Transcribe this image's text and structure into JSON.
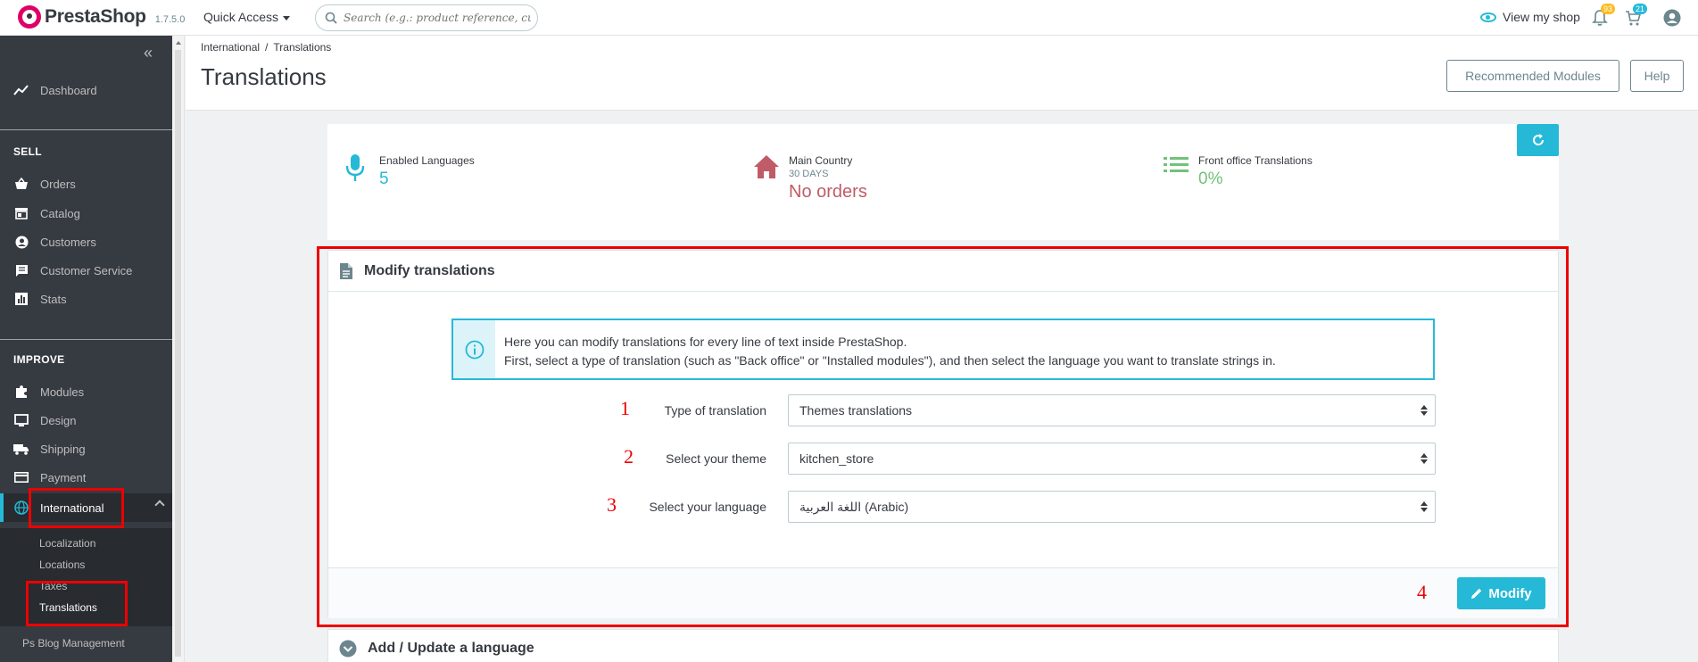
{
  "app": {
    "logo_text": "PrestaShop",
    "version": "1.7.5.0",
    "quick_access": "Quick Access",
    "search_placeholder": "Search (e.g.: product reference, customer name...)",
    "view_shop": "View my shop",
    "notifications_badge": "93",
    "orders_badge": "21",
    "accent_color": "#25b9d7"
  },
  "sidebar": {
    "dashboard": "Dashboard",
    "sell_title": "SELL",
    "sell_items": [
      "Orders",
      "Catalog",
      "Customers",
      "Customer Service",
      "Stats"
    ],
    "improve_title": "IMPROVE",
    "improve_items": [
      "Modules",
      "Design",
      "Shipping",
      "Payment"
    ],
    "active_item": "International",
    "submenu": [
      "Localization",
      "Locations",
      "Taxes",
      "Translations"
    ],
    "blog_item": "Ps Blog Management"
  },
  "header": {
    "breadcrumb": [
      "International",
      "Translations"
    ],
    "title": "Translations",
    "recommended_btn": "Recommended Modules",
    "help_btn": "Help"
  },
  "kpis": {
    "enabled_languages_label": "Enabled Languages",
    "enabled_languages_value": "5",
    "main_country_label": "Main Country",
    "main_country_sub": "30 DAYS",
    "main_country_value": "No orders",
    "front_office_label": "Front office Translations",
    "front_office_value": "0%"
  },
  "modify_panel": {
    "title": "Modify translations",
    "info_line1": "Here you can modify translations for every line of text inside PrestaShop.",
    "info_line2": "First, select a type of translation (such as \"Back office\" or \"Installed modules\"), and then select the language you want to translate strings in.",
    "rows": [
      {
        "step": "1",
        "label": "Type of translation",
        "value": "Themes translations"
      },
      {
        "step": "2",
        "label": "Select your theme",
        "value": "kitchen_store"
      },
      {
        "step": "3",
        "label": "Select your language",
        "value": "اللغة العربية (Arabic)"
      }
    ],
    "step4": "4",
    "modify_btn": "Modify"
  },
  "add_panel": {
    "title": "Add / Update a language"
  }
}
